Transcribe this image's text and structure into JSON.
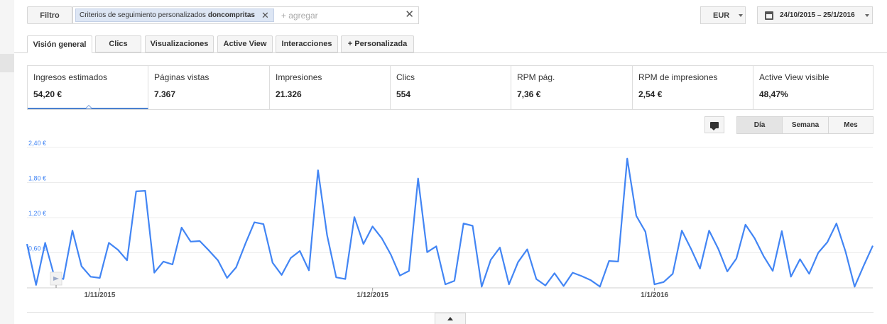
{
  "filter": {
    "button_label": "Filtro",
    "chip_prefix": "Criterios de seguimiento personalizados",
    "chip_value": "doncompritas",
    "add_placeholder": "+ agregar"
  },
  "currency": "EUR",
  "date_range": "24/10/2015 – 25/1/2016",
  "tabs": [
    "Visión general",
    "Clics",
    "Visualizaciones",
    "Active View",
    "Interacciones",
    "+ Personalizada"
  ],
  "active_tab": 0,
  "metrics": [
    {
      "label": "Ingresos estimados",
      "value": "54,20 €"
    },
    {
      "label": "Páginas vistas",
      "value": "7.367"
    },
    {
      "label": "Impresiones",
      "value": "21.326"
    },
    {
      "label": "Clics",
      "value": "554"
    },
    {
      "label": "RPM pág.",
      "value": "7,36 €"
    },
    {
      "label": "RPM de impresiones",
      "value": "2,54 €"
    },
    {
      "label": "Active View visible",
      "value": "48,47%"
    }
  ],
  "active_metric": 0,
  "periods": [
    "Día",
    "Semana",
    "Mes"
  ],
  "active_period": 0,
  "icons": {
    "annotation": "comment-icon",
    "calendar": "calendar-icon",
    "expand": "expand-up-icon"
  },
  "colors": {
    "line": "#4285f4",
    "axis_label": "#4285f4",
    "active_underline": "#4a80d0"
  },
  "chart_data": {
    "type": "line",
    "title": "",
    "xlabel": "",
    "ylabel": "",
    "y_ticks": [
      "2,40 €",
      "1,80 €",
      "1,20 €",
      "0,60 €"
    ],
    "y_tick_values": [
      2.4,
      1.8,
      1.2,
      0.6
    ],
    "ylim": [
      0,
      2.4
    ],
    "x_tick_labels": [
      "1/11/2015",
      "1/12/2015",
      "1/1/2016"
    ],
    "x_tick_dates": [
      "2015-11-01",
      "2015-12-01",
      "2016-01-01"
    ],
    "x_start": "2015-10-24",
    "x_end": "2016-01-25",
    "grid": true,
    "series": [
      {
        "name": "",
        "values": [
          0.75,
          0.05,
          0.77,
          0.2,
          0.15,
          0.98,
          0.37,
          0.19,
          0.17,
          0.77,
          0.65,
          0.47,
          1.65,
          1.66,
          0.26,
          0.45,
          0.4,
          1.03,
          0.79,
          0.8,
          0.64,
          0.47,
          0.17,
          0.35,
          0.75,
          1.12,
          1.09,
          0.43,
          0.22,
          0.51,
          0.63,
          0.3,
          2.01,
          0.9,
          0.18,
          0.15,
          1.21,
          0.75,
          1.05,
          0.85,
          0.57,
          0.21,
          0.29,
          1.87,
          0.61,
          0.71,
          0.06,
          0.12,
          1.1,
          1.06,
          0.02,
          0.48,
          0.69,
          0.06,
          0.44,
          0.66,
          0.15,
          0.04,
          0.25,
          0.03,
          0.26,
          0.2,
          0.13,
          0.02,
          0.46,
          0.45,
          2.21,
          1.23,
          0.96,
          0.06,
          0.1,
          0.24,
          0.98,
          0.67,
          0.33,
          0.98,
          0.67,
          0.28,
          0.5,
          1.08,
          0.85,
          0.54,
          0.29,
          0.97,
          0.19,
          0.49,
          0.24,
          0.6,
          0.78,
          1.1,
          0.62,
          0.02,
          0.38,
          0.72
        ]
      }
    ]
  }
}
